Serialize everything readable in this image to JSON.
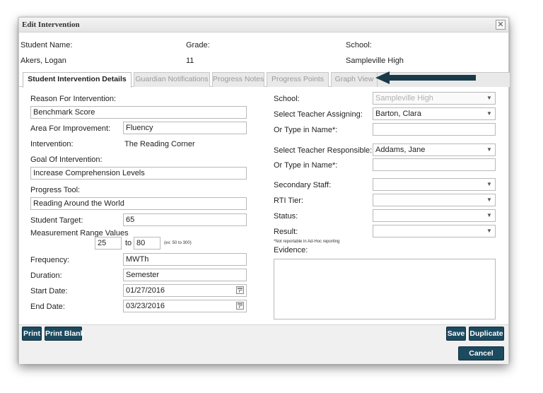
{
  "dialog": {
    "title": "Edit Intervention",
    "close_icon": "close-icon"
  },
  "header": {
    "student_name_label": "Student Name:",
    "student_name": "Akers, Logan",
    "grade_label": "Grade:",
    "grade": "11",
    "school_label": "School:",
    "school": "Sampleville High"
  },
  "tabs": [
    {
      "label": "Student Intervention Details",
      "active": true
    },
    {
      "label": "Guardian Notifications",
      "active": false
    },
    {
      "label": "Progress Notes",
      "active": false
    },
    {
      "label": "Progress Points",
      "active": false
    },
    {
      "label": "Graph View",
      "active": false
    }
  ],
  "annotation": {
    "arrow_color": "#1a3a4a"
  },
  "left": {
    "reason_label": "Reason For Intervention:",
    "reason_value": "Benchmark Score",
    "area_label": "Area For Improvement:",
    "area_value": "Fluency",
    "intervention_label": "Intervention:",
    "intervention_value": "The Reading Corner",
    "goal_label": "Goal Of Intervention:",
    "goal_value": "Increase Comprehension Levels",
    "progress_tool_label": "Progress Tool:",
    "progress_tool_value": "Reading Around the World",
    "target_label": "Student Target:",
    "target_value": "65",
    "range_label": "Measurement Range Values",
    "range_min": "25",
    "range_to": "to",
    "range_max": "80",
    "range_hint": "(ex: 50 to 300)",
    "frequency_label": "Frequency:",
    "frequency_value": "MWTh",
    "duration_label": "Duration:",
    "duration_value": "Semester",
    "start_label": "Start Date:",
    "start_value": "01/27/2016",
    "end_label": "End Date:",
    "end_value": "03/23/2016"
  },
  "right": {
    "school_label": "School:",
    "school_value": "Sampleville High",
    "teacher_assigning_label": "Select Teacher Assigning:",
    "teacher_assigning_value": "Barton, Clara",
    "type_name_label_1": "Or Type in Name*:",
    "type_name_value_1": "",
    "teacher_responsible_label": "Select Teacher Responsible:",
    "teacher_responsible_value": "Addams, Jane",
    "type_name_label_2": "Or Type in Name*:",
    "type_name_value_2": "",
    "secondary_staff_label": "Secondary Staff:",
    "secondary_staff_value": "",
    "rti_tier_label": "RTI Tier:",
    "rti_tier_value": "",
    "status_label": "Status:",
    "status_value": "",
    "result_label": "Result:",
    "result_value": "",
    "adhoc_note": "*Not reportable in Ad-Hoc reporting",
    "evidence_label": "Evidence:",
    "evidence_value": ""
  },
  "footer": {
    "print_label": "Print",
    "print_blank_label": "Print Blank",
    "save_label": "Save",
    "duplicate_label": "Duplicate",
    "cancel_label": "Cancel",
    "button_color": "#1c4a5f"
  }
}
